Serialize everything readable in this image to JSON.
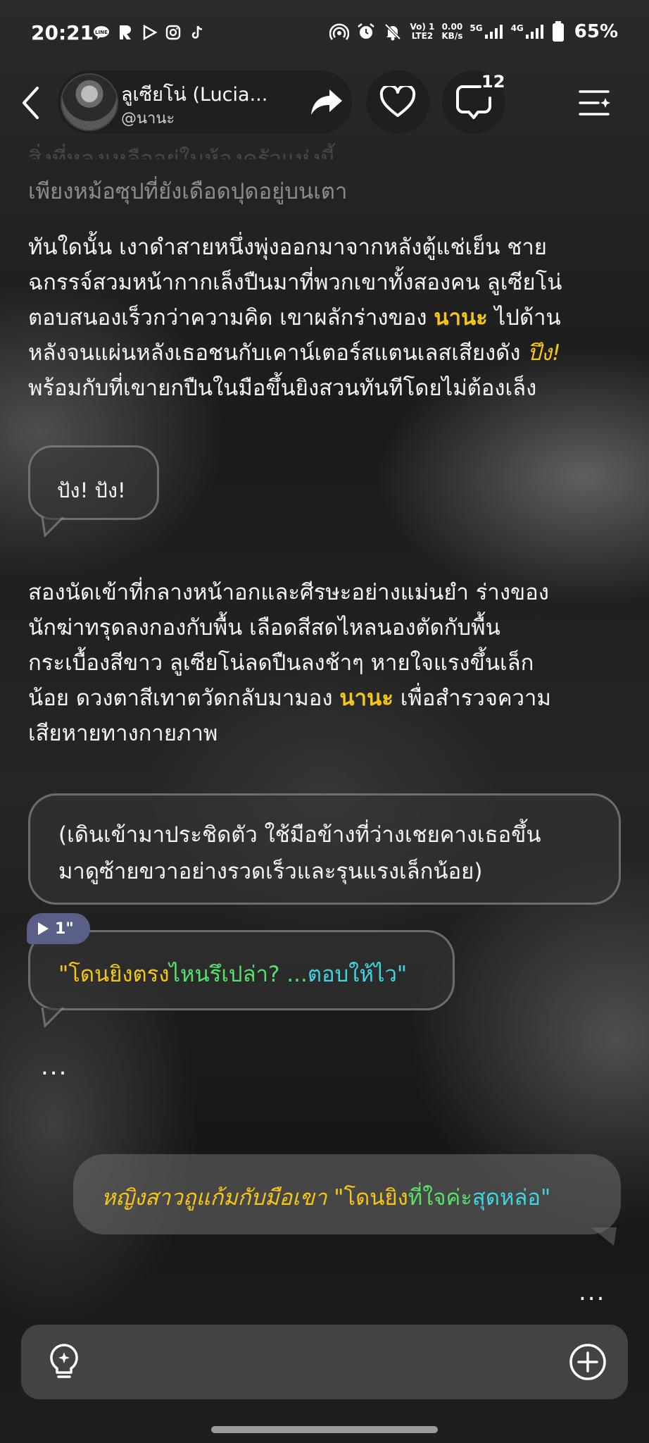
{
  "status_bar": {
    "time": "20:21",
    "left_icons": [
      "line-icon",
      "r-app-icon",
      "play-icon",
      "instagram-icon",
      "tiktok-icon"
    ],
    "volte": "Vo) 1\nLTE2",
    "speed_value": "0.00",
    "speed_unit": "KB/s",
    "net_5g": "5G",
    "net_4g": "4G",
    "battery": "65%"
  },
  "header": {
    "character_name": "ลูเซียโน่ (Lucia...",
    "handle": "@นานะ",
    "comment_count": "12"
  },
  "story": {
    "faded_line": "เพียงหม้อซุปที่ยังเดือดปุดอยู่บนเตา",
    "para1": {
      "l1": "ทันใดนั้น เงาดำสายหนึ่งพุ่งออกมาจากหลังตู้แช่เย็น ชาย",
      "l2": "ฉกรรจ์สวมหน้ากากเล็งปืนมาที่พวกเขาทั้งสองคน ลูเซียโน่",
      "l3a": "ตอบสนองเร็วกว่าความคิด เขาผลักร่างของ ",
      "l3_name": "นานะ",
      "l3b": " ไปด้าน",
      "l4a": "หลังจนแผ่นหลังเธอชนกับเคาน์เตอร์สแตนเลสเสียงดัง ",
      "l4_sfx": "ปึง!",
      "l5": "พร้อมกับที่เขายกปืนในมือขึ้นยิงสวนทันทีโดยไม่ต้องเล็ง"
    },
    "gunshot_bubble": "ปัง! ปัง!",
    "para2": {
      "l1": "สองนัดเข้าที่กลางหน้าอกและศีรษะอย่างแม่นยำ ร่างของ",
      "l2": "นักฆ่าทรุดลงกองกับพื้น เลือดสีสดไหลนองตัดกับพื้น",
      "l3": "กระเบื้องสีขาว ลูเซียโน่ลดปืนลงช้าๆ หายใจแรงขึ้นเล็ก",
      "l4a": "น้อย ดวงตาสีเทาตวัดกลับมามอง ",
      "l4_name": "นานะ",
      "l4b": " เพื่อสำรวจความ",
      "l5": "เสียหายทางกายภาพ"
    },
    "action_box": {
      "l1": "(เดินเข้ามาประชิดตัว ใช้มือข้างที่ว่างเชยคางเธอขึ้น",
      "l2": "มาดูซ้ายขวาอย่างรวดเร็วและรุนแรงเล็กน้อย)"
    },
    "voice": {
      "duration": "1\"",
      "q_open": "\"โดนยิงตรง",
      "q_mid": "ไหนรึเปล่า? ...",
      "q_end": "ตอบให้ไว\""
    },
    "ellipsis_1": "...",
    "user_message": {
      "action": "หญิงสาวถูแก้มกับมือเขา ",
      "q_open": "\"โดนยิง",
      "q_mid": "ที่ใจค่ะ",
      "q_end": "สุดหล่อ\""
    },
    "ellipsis_2": "..."
  },
  "input": {
    "placeholder": ""
  },
  "colors": {
    "highlight_name": "#f5c518",
    "voice_badge": "#5a5f88",
    "quote_green": "#58e06c",
    "quote_cyan": "#3fd6e0"
  }
}
